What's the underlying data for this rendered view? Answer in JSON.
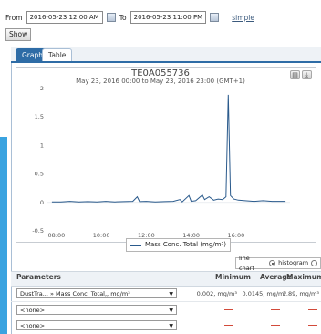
{
  "controls": {
    "from_label": "From",
    "from_value": "2016-05-23 12:00 AM",
    "to_label": "To",
    "to_value": "2016-05-23 11:00 PM",
    "simple_link": "simple",
    "show_button": "Show"
  },
  "tabs": [
    {
      "label": "Graph",
      "active": true
    },
    {
      "label": "Table",
      "active": false
    }
  ],
  "chart_header": {
    "title": "TE0A055736",
    "subtitle": "May 23, 2016 00:00 to May 23, 2016 23:00 (GMT+1)"
  },
  "chart_data": {
    "type": "line",
    "title": "TE0A055736",
    "subtitle": "May 23, 2016 00:00 to May 23, 2016 23:00 (GMT+1)",
    "xlabel": "",
    "ylabel": "",
    "x_ticks": [
      "08:00",
      "10:00",
      "12:00",
      "14:00",
      "16:00"
    ],
    "y_ticks": [
      "-0.5",
      "0",
      "0.5",
      "1",
      "1.5",
      "2"
    ],
    "ylim": [
      -0.5,
      2
    ],
    "xlim_hours": [
      7.6,
      18.4
    ],
    "grid": false,
    "legend_position": "bottom",
    "series": [
      {
        "name": "Mass Conc. Total (mg/m³)",
        "color": "#2a5a8c",
        "points": [
          [
            7.8,
            0.01
          ],
          [
            8.2,
            0.01
          ],
          [
            8.6,
            0.02
          ],
          [
            9.0,
            0.01
          ],
          [
            9.4,
            0.015
          ],
          [
            9.8,
            0.01
          ],
          [
            10.2,
            0.02
          ],
          [
            10.6,
            0.01
          ],
          [
            11.0,
            0.015
          ],
          [
            11.4,
            0.02
          ],
          [
            11.6,
            0.1
          ],
          [
            11.7,
            0.015
          ],
          [
            12.0,
            0.02
          ],
          [
            12.4,
            0.01
          ],
          [
            12.8,
            0.015
          ],
          [
            13.2,
            0.02
          ],
          [
            13.5,
            0.05
          ],
          [
            13.6,
            0.01
          ],
          [
            13.9,
            0.12
          ],
          [
            14.0,
            0.02
          ],
          [
            14.2,
            0.03
          ],
          [
            14.5,
            0.13
          ],
          [
            14.6,
            0.05
          ],
          [
            14.8,
            0.1
          ],
          [
            15.0,
            0.04
          ],
          [
            15.2,
            0.06
          ],
          [
            15.4,
            0.05
          ],
          [
            15.55,
            0.1
          ],
          [
            15.65,
            1.89
          ],
          [
            15.75,
            0.12
          ],
          [
            15.9,
            0.06
          ],
          [
            16.1,
            0.04
          ],
          [
            16.4,
            0.03
          ],
          [
            16.8,
            0.02
          ],
          [
            17.2,
            0.03
          ],
          [
            17.6,
            0.02
          ],
          [
            18.2,
            0.02
          ]
        ]
      }
    ]
  },
  "chart_mode": {
    "line_chart": "line chart",
    "histogram": "histogram",
    "selected": "line chart"
  },
  "parameters": {
    "header": "Parameters",
    "col_min": "Minimum",
    "col_avg": "Average",
    "col_max": "Maximum",
    "rows": [
      {
        "name": "DustTra... » Mass Conc. Total,, mg/m³",
        "min": "0.002, mg/m³",
        "avg": "0.0145, mg/m³",
        "max": "1.89, mg/m³"
      },
      {
        "name": "<none>",
        "min": "—",
        "avg": "—",
        "max": "—"
      },
      {
        "name": "<none>",
        "min": "—",
        "avg": "—",
        "max": "—"
      }
    ]
  },
  "colors": {
    "accent": "#2e6ca6",
    "series": "#2a5a8c",
    "dash": "#d24a3a",
    "left_bar": "#3aa3e0"
  }
}
